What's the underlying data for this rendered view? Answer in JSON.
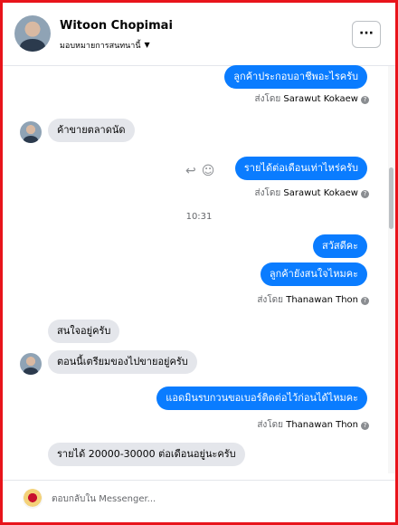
{
  "header": {
    "name": "Witoon Chopimai",
    "assign_label": "มอบหมายการสนทนานี้",
    "more_label": "···"
  },
  "messages": [
    {
      "side": "out",
      "text": "ลูกค้าประกอบอาชีพอะไรครับ"
    },
    {
      "side": "out_sender",
      "prefix": "ส่งโดย",
      "name": "Sarawut Kokaew"
    },
    {
      "side": "in",
      "text": "ค้าขายตลาดนัด"
    },
    {
      "side": "out",
      "text": "รายได้ต่อเดือนเท่าไหร่ครับ"
    },
    {
      "side": "out_sender",
      "prefix": "ส่งโดย",
      "name": "Sarawut Kokaew"
    },
    {
      "side": "time",
      "text": "10:31"
    },
    {
      "side": "out",
      "text": "สวัสดีคะ"
    },
    {
      "side": "out",
      "text": "ลูกค้ายังสนใจไหมคะ"
    },
    {
      "side": "out_sender",
      "prefix": "ส่งโดย",
      "name": "Thanawan Thon"
    },
    {
      "side": "in",
      "text": "สนใจอยู่ครับ"
    },
    {
      "side": "in",
      "text": "ตอนนี้เตรียมของไปขายอยู่ครับ"
    },
    {
      "side": "out",
      "text": "แอดมินรบกวนขอเบอร์ติดต่อไว้ก่อนได้ไหมคะ"
    },
    {
      "side": "out_sender",
      "prefix": "ส่งโดย",
      "name": "Thanawan Thon"
    },
    {
      "side": "in",
      "text": "รายได้ 20000-30000 ต่อเดือนอยู่นะครับ"
    }
  ],
  "composer": {
    "placeholder": "ตอบกลับใน Messenger..."
  },
  "icons": {
    "more": "more-horizontal-icon",
    "dropdown": "chevron-down-icon",
    "reply": "reply-icon",
    "emoji": "emoji-icon",
    "info": "question-circle-icon"
  },
  "colors": {
    "outgoing_bubble": "#0a7cff",
    "incoming_bubble": "#e4e6eb",
    "frame": "#e8141b"
  }
}
